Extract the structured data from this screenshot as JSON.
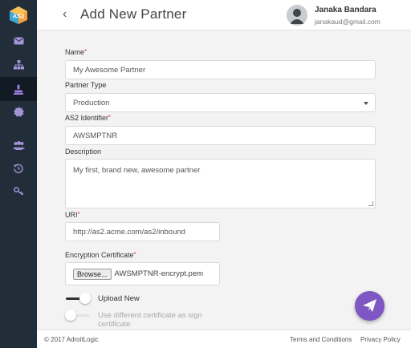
{
  "app": {
    "logo_text": "AS2",
    "accent_color": "#7e57c2",
    "sidebar_color": "#222d3a"
  },
  "sidebar": {
    "items": [
      {
        "icon": "envelope-icon",
        "active": false
      },
      {
        "icon": "sitemap-icon",
        "active": false
      },
      {
        "icon": "user-icon",
        "active": true
      },
      {
        "icon": "certificate-icon",
        "active": false
      },
      {
        "icon": "users-icon",
        "active": false
      },
      {
        "icon": "history-icon",
        "active": false
      },
      {
        "icon": "key-icon",
        "active": false
      }
    ]
  },
  "header": {
    "back_symbol": "‹",
    "title": "Add New Partner",
    "user_name": "Janaka Bandara",
    "user_email": "janakaud@gmail.com"
  },
  "form": {
    "name_label": "Name",
    "name_value": "My Awesome Partner",
    "partner_type_label": "Partner Type",
    "partner_type_value": "Production",
    "as2_id_label": "AS2 Identifier",
    "as2_id_value": "AWSMPTNR",
    "description_label": "Description",
    "description_value": "My first, brand new, awesome partner",
    "uri_label": "URI",
    "uri_value": "http://as2.acme.com/as2/inbound",
    "enc_cert_label": "Encryption Certificate",
    "browse_label": "Browse...",
    "enc_cert_file": "AWSMPTNR-encrypt.pem",
    "required_mark": "*",
    "upload_new_label": "Upload New",
    "upload_new_on": true,
    "sign_cert_label": "Use different certificate as sign certificate",
    "sign_cert_on": false
  },
  "footer": {
    "copyright": "© 2017 AdroitLogic",
    "terms": "Terms and Conditions",
    "privacy": "Privacy Policy"
  }
}
